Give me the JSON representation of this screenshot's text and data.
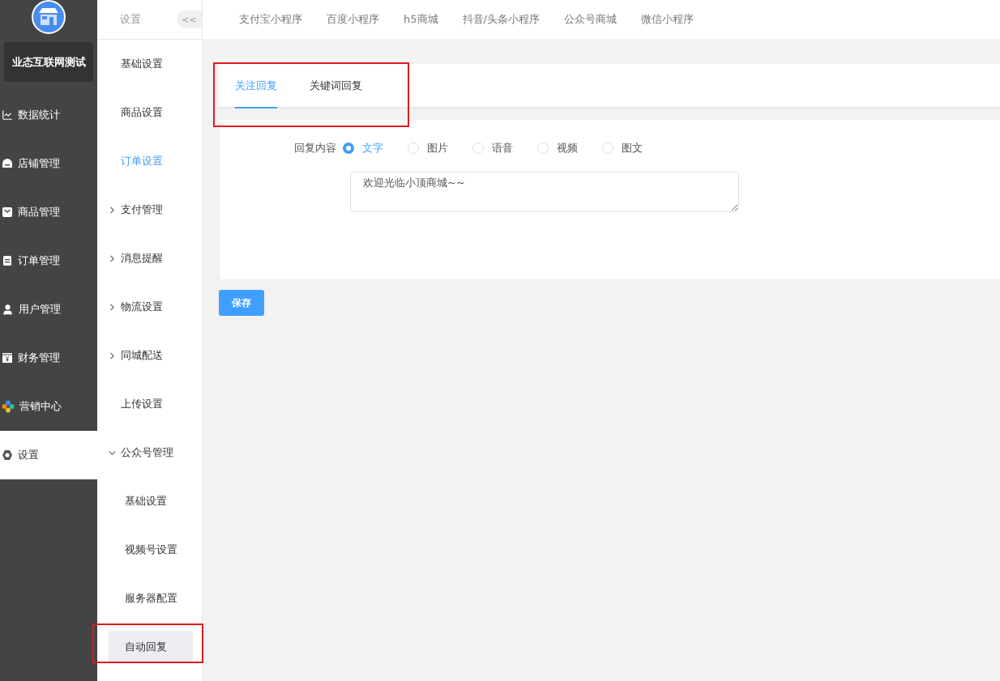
{
  "brand": {
    "name": "业态互联网测试"
  },
  "main_menu": [
    {
      "label": "数据统计",
      "selected": false
    },
    {
      "label": "店铺管理",
      "selected": false
    },
    {
      "label": "商品管理",
      "selected": false
    },
    {
      "label": "订单管理",
      "selected": false
    },
    {
      "label": "用户管理",
      "selected": false
    },
    {
      "label": "财务管理",
      "selected": false
    },
    {
      "label": "营销中心",
      "selected": false
    },
    {
      "label": "设置",
      "selected": true
    }
  ],
  "sub_menu": {
    "title": "设置",
    "collapse": "<<",
    "items": [
      {
        "label": "基础设置",
        "selected": false
      },
      {
        "label": "商品设置",
        "selected": false
      },
      {
        "label": "订单设置",
        "selected": true
      },
      {
        "label": "支付管理",
        "selected": false,
        "expanded": false
      },
      {
        "label": "消息提醒",
        "selected": false,
        "expanded": false
      },
      {
        "label": "物流设置",
        "selected": false,
        "expanded": false
      },
      {
        "label": "同城配送",
        "selected": false,
        "expanded": false
      },
      {
        "label": "上传设置",
        "selected": false
      },
      {
        "label": "公众号管理",
        "selected": false,
        "expanded": true,
        "children": [
          {
            "label": "基础设置",
            "selected": false,
            "highlighted": false
          },
          {
            "label": "视频号设置",
            "selected": false,
            "highlighted": false
          },
          {
            "label": "服务器配置",
            "selected": false,
            "highlighted": false
          },
          {
            "label": "自动回复",
            "selected": true,
            "highlighted": true
          }
        ]
      }
    ]
  },
  "top_nav": [
    "支付宝小程序",
    "百度小程序",
    "h5商城",
    "抖音/头条小程序",
    "公众号商城",
    "微信小程序"
  ],
  "reply_tabs": {
    "highlighted": true,
    "tabs": [
      {
        "label": "关注回复",
        "selected": true
      },
      {
        "label": "关键词回复",
        "selected": false
      }
    ]
  },
  "form": {
    "label": "回复内容",
    "options": [
      {
        "label": "文字",
        "selected": true
      },
      {
        "label": "图片",
        "selected": false
      },
      {
        "label": "语音",
        "selected": false
      },
      {
        "label": "视频",
        "selected": false
      },
      {
        "label": "图文",
        "selected": false
      }
    ],
    "value": "欢迎光临小顶商城~~"
  },
  "save_button": "保存"
}
